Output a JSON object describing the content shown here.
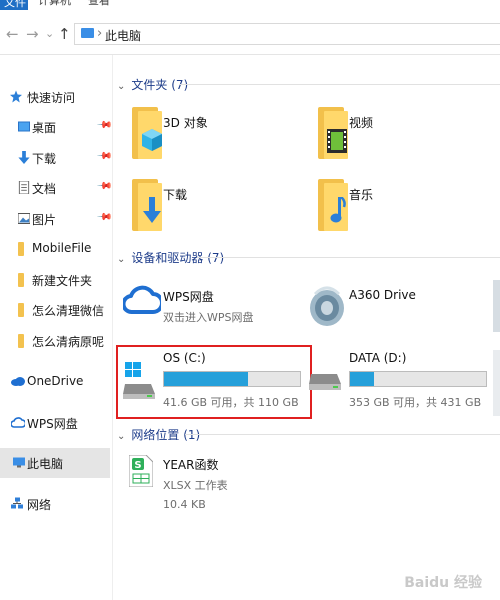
{
  "ribbon": {
    "tabs": [
      "文件",
      "计算机",
      "查看"
    ]
  },
  "address": {
    "crumb": "此电脑",
    "sep": "›",
    "back": "←",
    "forward": "→",
    "recent": "⌄",
    "up": "↑"
  },
  "nav": {
    "items": [
      {
        "label": "快速访问"
      },
      {
        "label": "桌面"
      },
      {
        "label": "下载"
      },
      {
        "label": "文档"
      },
      {
        "label": "图片"
      },
      {
        "label": "MobileFile"
      },
      {
        "label": "新建文件夹"
      },
      {
        "label": "怎么清理微信"
      },
      {
        "label": "怎么清病原呢"
      },
      {
        "label": "OneDrive"
      },
      {
        "label": "WPS网盘"
      },
      {
        "label": "此电脑"
      },
      {
        "label": "网络"
      }
    ]
  },
  "groups": {
    "folders": {
      "title": "文件夹 (7)",
      "items": [
        {
          "label": "3D 对象"
        },
        {
          "label": "视频"
        },
        {
          "label": "下载"
        },
        {
          "label": "音乐"
        }
      ]
    },
    "devices": {
      "title": "设备和驱动器 (7)",
      "wps": {
        "name": "WPS网盘",
        "sub": "双击进入WPS网盘"
      },
      "a360": {
        "name": "A360 Drive"
      },
      "os": {
        "name": "OS (C:)",
        "space": "41.6 GB 可用，共 110 GB",
        "used_fraction": 0.62
      },
      "data": {
        "name": "DATA (D:)",
        "space": "353 GB 可用，共 431 GB",
        "used_fraction": 0.18
      }
    },
    "network": {
      "title": "网络位置 (1)",
      "file": {
        "name": "YEAR函数",
        "type": "XLSX 工作表",
        "size": "10.4 KB"
      }
    }
  },
  "watermark": "Baidu 经验"
}
